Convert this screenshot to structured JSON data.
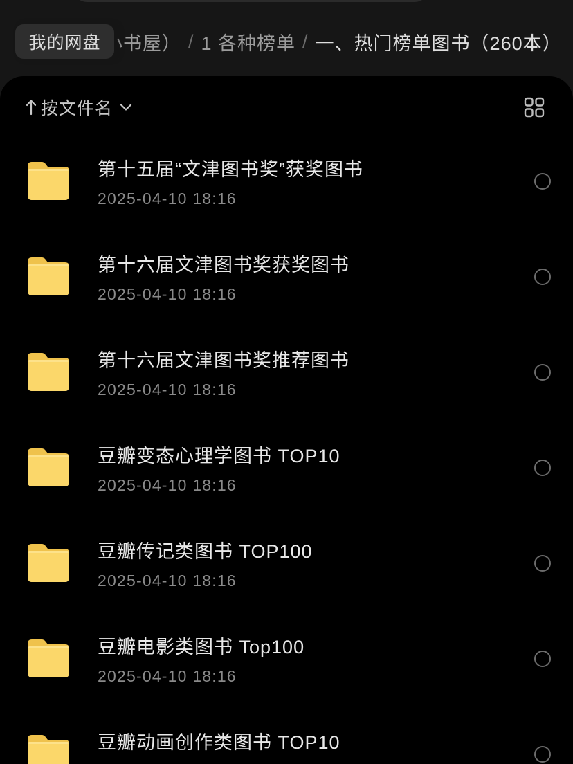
{
  "header": {
    "breadcrumb": {
      "root_label": "我的网盘",
      "separator": "/",
      "items": [
        {
          "label": "小书屋）"
        },
        {
          "label": "1 各种榜单"
        },
        {
          "label": "一、热门榜单图书（260本）"
        }
      ]
    }
  },
  "toolbar": {
    "sort_label": "按文件名",
    "sort_direction_icon": "arrow-up-icon",
    "sort_dropdown_icon": "chevron-down-icon",
    "view_toggle_icon": "grid-view-icon"
  },
  "files": {
    "item_icon": "folder-icon",
    "items": [
      {
        "name": "第十五届“文津图书奖”获奖图书",
        "date": "2025-04-10 18:16"
      },
      {
        "name": "第十六届文津图书奖获奖图书",
        "date": "2025-04-10 18:16"
      },
      {
        "name": "第十六届文津图书奖推荐图书",
        "date": "2025-04-10 18:16"
      },
      {
        "name": "豆瓣变态心理学图书 TOP10",
        "date": "2025-04-10 18:16"
      },
      {
        "name": "豆瓣传记类图书 TOP100",
        "date": "2025-04-10 18:16"
      },
      {
        "name": "豆瓣电影类图书 Top100",
        "date": "2025-04-10 18:16"
      },
      {
        "name": "豆瓣动画创作类图书 TOP10"
      }
    ]
  },
  "colors": {
    "header_background": "#161616",
    "panel_background": "#000000",
    "folder_front": "#fbd76a",
    "folder_back": "#efc24c",
    "primary_text": "#e8e8e8",
    "secondary_text": "#8a8a8a"
  }
}
